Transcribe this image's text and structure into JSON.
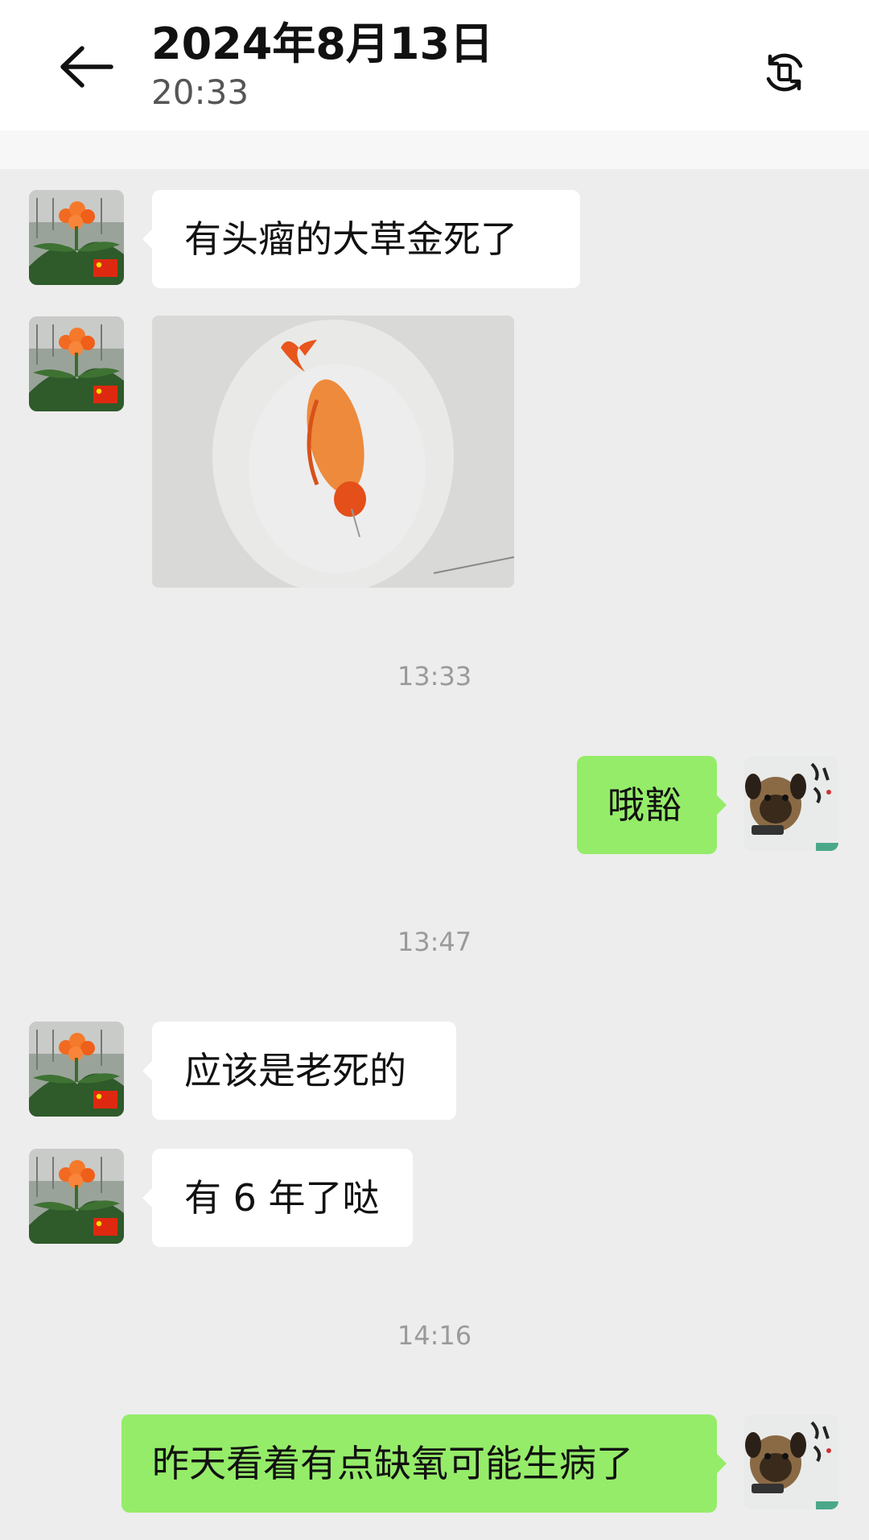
{
  "header": {
    "title": "2024年8月13日",
    "subtitle": "20:33",
    "back_icon": "arrow-left-icon",
    "right_icon": "rotate-screen-icon"
  },
  "messages": [
    {
      "from": "other",
      "text": "有头瘤的大草金死了"
    },
    {
      "from": "other",
      "type": "image",
      "image": "dead-goldfish-photo"
    },
    {
      "type": "time",
      "text": "13:33"
    },
    {
      "from": "me",
      "text": "哦豁"
    },
    {
      "type": "time",
      "text": "13:47"
    },
    {
      "from": "other",
      "text": "应该是老死的"
    },
    {
      "from": "other",
      "text": "有 6 年了哒"
    },
    {
      "type": "time",
      "text": "14:16"
    },
    {
      "from": "me",
      "text": "昨天看着有点缺氧可能生病了"
    }
  ],
  "colors": {
    "background": "#ededed",
    "bubble_self": "#95ec69",
    "bubble_other": "#ffffff",
    "timestamp": "#9a9a9a"
  }
}
